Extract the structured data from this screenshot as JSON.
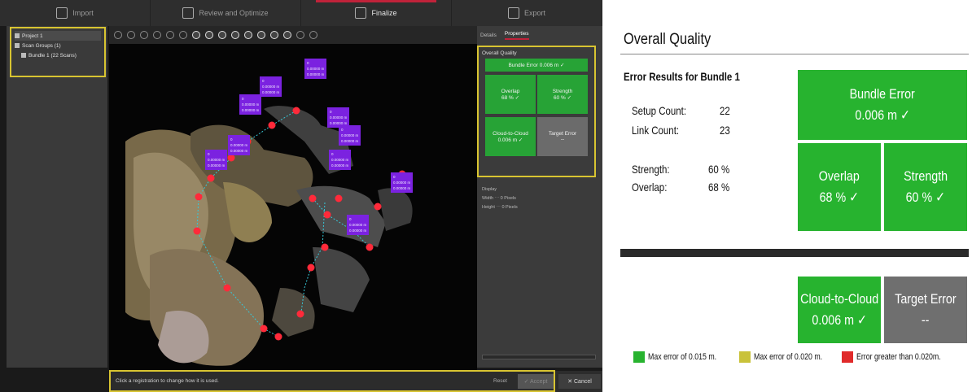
{
  "app": {
    "steps": [
      {
        "label": "Import",
        "active": false
      },
      {
        "label": "Review and Optimize",
        "active": false
      },
      {
        "label": "Finalize",
        "active": true
      },
      {
        "label": "Export",
        "active": false
      }
    ],
    "tree": [
      {
        "label": "Project 1"
      },
      {
        "label": "Scan Groups (1)"
      },
      {
        "label": "Bundle 1 (22 Scans)"
      }
    ],
    "right_tabs": [
      "Details",
      "Properties"
    ],
    "mini_quality": {
      "title": "Overall Quality",
      "bundle": "Bundle Error  0.006 m  ✓",
      "overlap": "Overlap\n68 %  ✓",
      "strength": "Strength\n60 %  ✓",
      "cloud": "Cloud-to-Cloud\n0.006 m  ✓",
      "target": "Target Error\n--"
    },
    "info_lines": [
      "Display",
      "Width       ⋯  0 Pixels",
      "Height      ⋯  0 Pixels"
    ],
    "status_message": "Click a registration to change how it is used.",
    "reset_label": "Reset",
    "accept_label": "✓ Accept",
    "cancel_label": "✕ Cancel",
    "scan_labels": [
      [
        "0",
        "0.00000 m",
        "0.00000 m"
      ],
      [
        "0",
        "0.00000 m",
        "0.00000 m"
      ],
      [
        "0",
        "0.00000 m",
        "0.00000 m"
      ],
      [
        "0",
        "0.00000 m",
        "0.00000 m"
      ],
      [
        "0",
        "0.00000 m",
        "0.00000 m"
      ],
      [
        "0",
        "0.00000 m",
        "0.00000 m"
      ],
      [
        "0",
        "0.00000 m",
        "0.00000 m"
      ],
      [
        "0",
        "0.00000 m",
        "0.00000 m"
      ],
      [
        "0",
        "0.00000 m",
        "0.00000 m"
      ],
      [
        "0",
        "0.00000 m",
        "0.00000 m"
      ]
    ]
  },
  "zoom": {
    "title": "Overall Quality",
    "error_heading": "Error Results for Bundle 1",
    "stats": [
      {
        "label": "Setup Count:",
        "value": "22"
      },
      {
        "label": "Link Count:",
        "value": "23"
      },
      {
        "label": "Strength:",
        "value": "60 %"
      },
      {
        "label": "Overlap:",
        "value": "68 %"
      }
    ],
    "bundle_error": {
      "title": "Bundle Error",
      "value": "0.006 m  ✓"
    },
    "overlap": {
      "title": "Overlap",
      "value": "68 %   ✓"
    },
    "strength": {
      "title": "Strength",
      "value": "60 %   ✓"
    },
    "cloud_to_cloud": {
      "title": "Cloud-to-Cloud",
      "value": "0.006 m  ✓"
    },
    "target_error": {
      "title": "Target Error",
      "value": "--"
    },
    "legend": [
      {
        "color": "#27b32f",
        "text": "Max error of 0.015 m."
      },
      {
        "color": "#c9c23a",
        "text": "Max error of 0.020 m."
      },
      {
        "color": "#e02a2a",
        "text": "Error greater than 0.020m."
      }
    ]
  },
  "colors": {
    "accent_green": "#27b32f",
    "highlight_yellow": "#d8c431",
    "scan_purple": "#7b22e0",
    "scan_red": "#ff2a3a"
  }
}
